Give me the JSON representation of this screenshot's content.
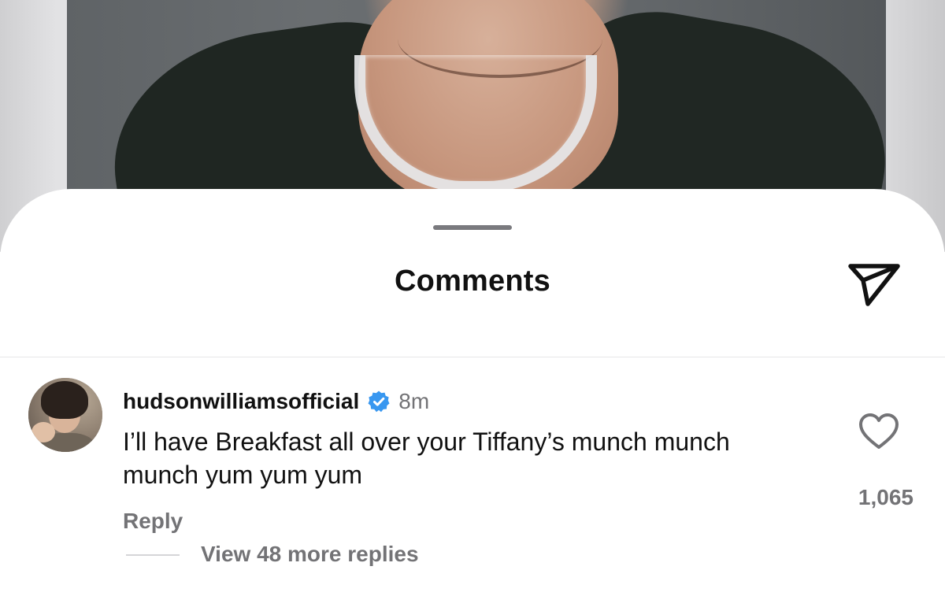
{
  "sheet": {
    "title": "Comments",
    "share_icon": "send-icon"
  },
  "comment": {
    "username": "hudsonwilliamsofficial",
    "verified": true,
    "timestamp": "8m",
    "text": "I’ll have Breakfast all over your Tiffany’s munch munch munch yum yum yum",
    "reply_label": "Reply",
    "view_replies_label": "View 48 more replies",
    "like_count": "1,065",
    "like_icon": "heart-outline-icon"
  },
  "colors": {
    "verified_badge": "#3897f0",
    "secondary_text": "#737376",
    "primary_text": "#111111"
  }
}
